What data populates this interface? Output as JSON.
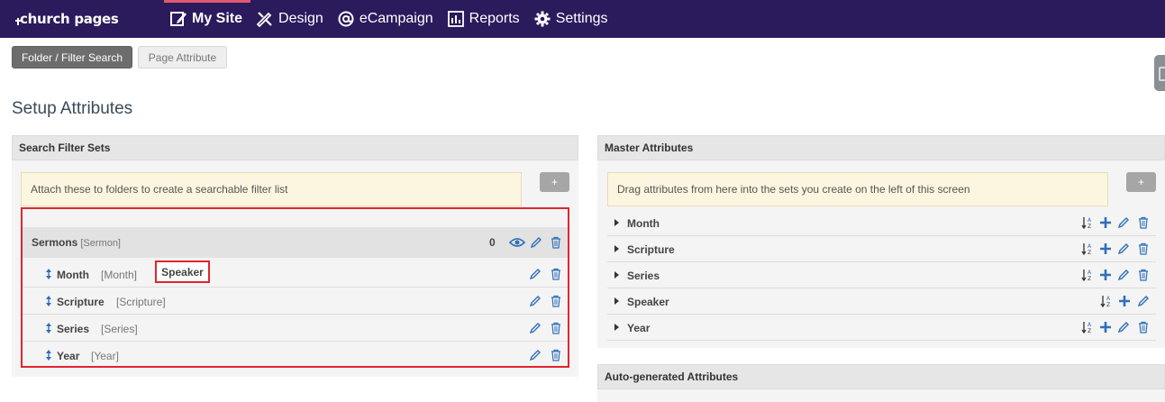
{
  "brand": {
    "logo_text": "church pages"
  },
  "nav": {
    "items": [
      {
        "label": "My Site",
        "icon": "edit-square-icon",
        "active": true
      },
      {
        "label": "Design",
        "icon": "design-tools-icon"
      },
      {
        "label": "eCampaign",
        "icon": "at-sign-icon"
      },
      {
        "label": "Reports",
        "icon": "bar-chart-icon"
      },
      {
        "label": "Settings",
        "icon": "gear-icon"
      }
    ]
  },
  "tabs": {
    "folder_filter": "Folder / Filter Search",
    "page_attribute": "Page Attribute"
  },
  "page_title": "Setup Attributes",
  "search_filter_sets": {
    "title": "Search Filter Sets",
    "notice": "Attach these to folders to create a searchable filter list",
    "add_label": "+",
    "set": {
      "name": "Sermons",
      "tag": "[Sermon]",
      "count": "0",
      "rows": [
        {
          "name": "Month",
          "tag": "[Month]"
        },
        {
          "name": "Scripture",
          "tag": "[Scripture]"
        },
        {
          "name": "Series",
          "tag": "[Series]"
        },
        {
          "name": "Year",
          "tag": "[Year]"
        }
      ]
    },
    "dragging_label": "Speaker"
  },
  "master_attributes": {
    "title": "Master Attributes",
    "notice": "Drag attributes from here into the sets you create on the left of this screen",
    "add_label": "+",
    "rows": [
      {
        "name": "Month"
      },
      {
        "name": "Scripture"
      },
      {
        "name": "Series"
      },
      {
        "name": "Speaker"
      },
      {
        "name": "Year"
      }
    ]
  },
  "auto_generated": {
    "title": "Auto-generated Attributes"
  },
  "colors": {
    "nav_bg": "#2b1a5c",
    "active_accent": "#e05a6d",
    "icon_blue": "#2f6fb8",
    "highlight_red": "#e0262b"
  }
}
